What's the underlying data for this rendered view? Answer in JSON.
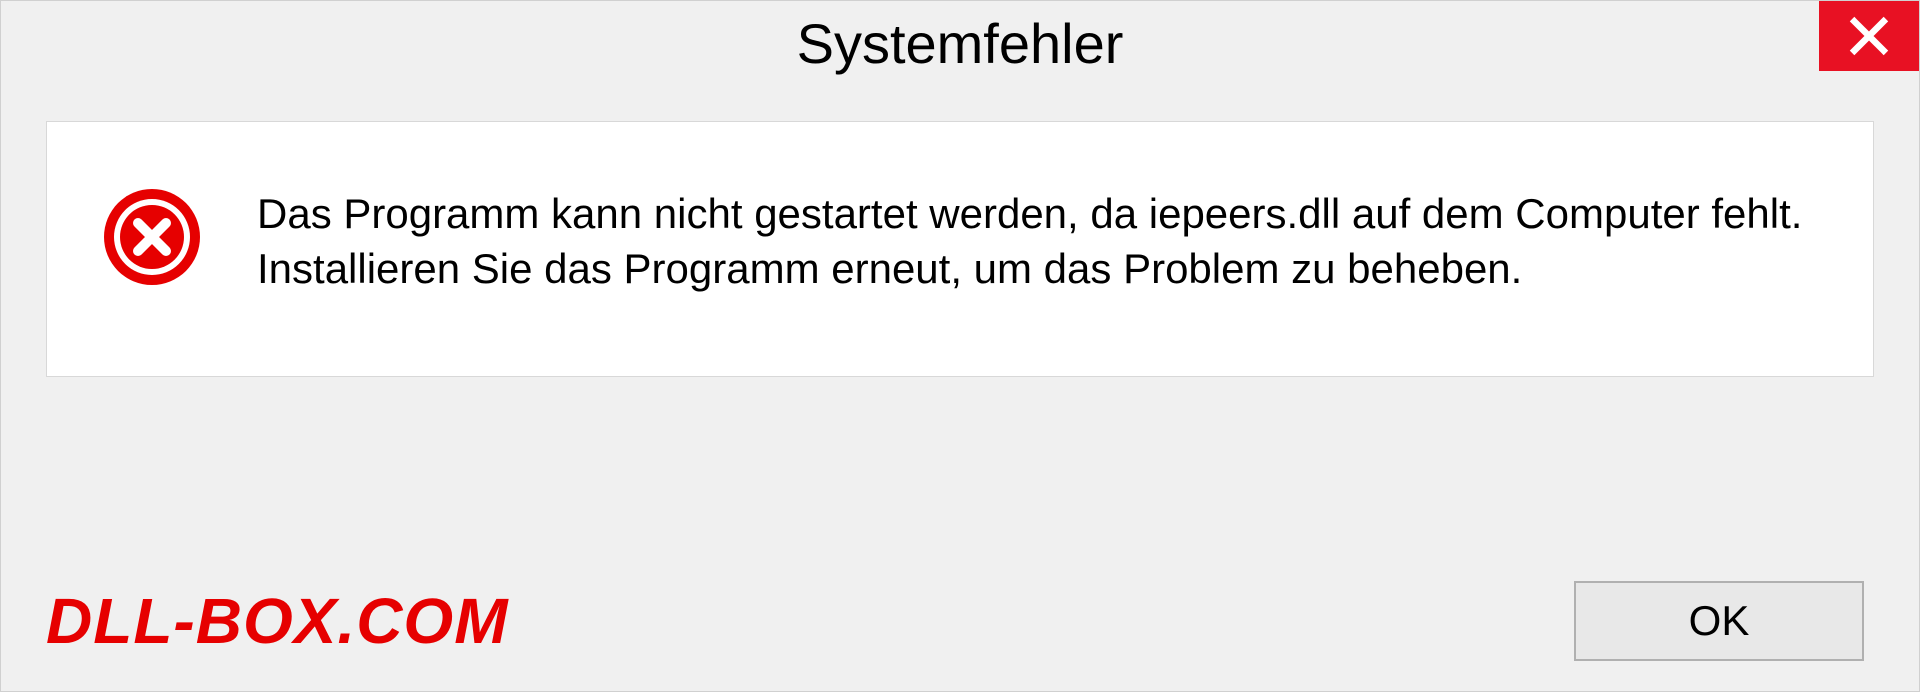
{
  "dialog": {
    "title": "Systemfehler",
    "message": "Das Programm kann nicht gestartet werden, da iepeers.dll auf dem Computer fehlt. Installieren Sie das Programm erneut, um das Problem zu beheben.",
    "ok_label": "OK"
  },
  "watermark": "DLL-BOX.COM"
}
